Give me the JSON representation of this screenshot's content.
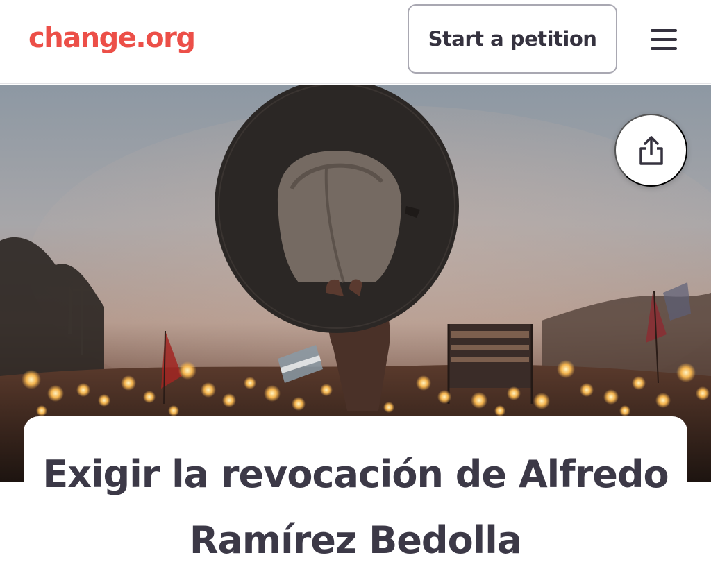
{
  "header": {
    "logo_text": "change.org",
    "start_button_label": "Start a petition",
    "menu_icon": "hamburger-menu-icon"
  },
  "hero": {
    "share_icon": "share-icon"
  },
  "petition": {
    "title": "Exigir la revocación de Alfredo Ramírez Bedolla"
  },
  "colors": {
    "brand": "#ec4f48",
    "text_dark": "#35323f",
    "title_text": "#3c3947",
    "button_border": "#a9a8b2"
  }
}
